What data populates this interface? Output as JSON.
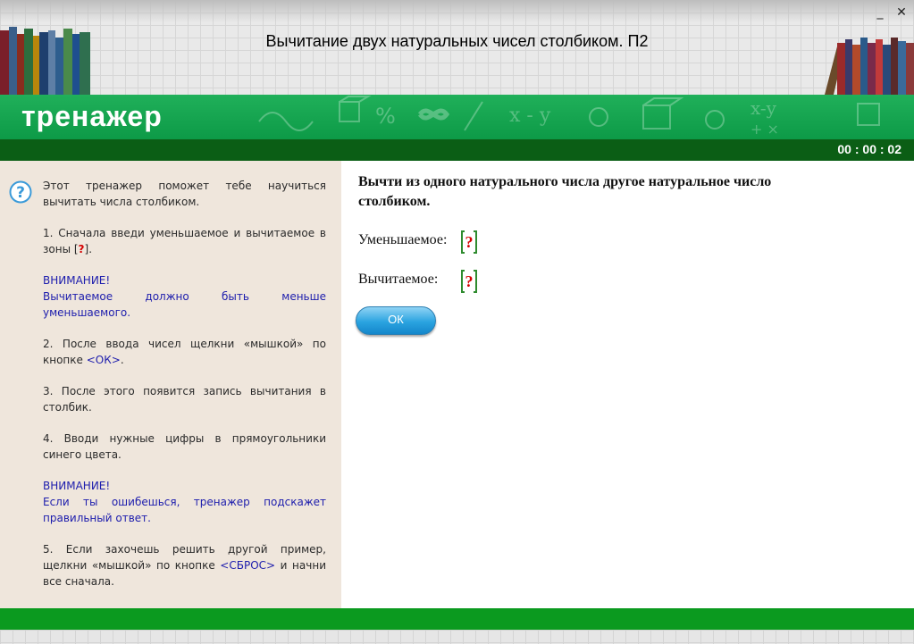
{
  "window": {
    "title": "Вычитание двух натуральных чисел столбиком. П2",
    "minimize_label": "_",
    "close_label": "✕"
  },
  "banner": {
    "text": "тренажер"
  },
  "timer": {
    "value": "00 : 00 : 02"
  },
  "instructions": {
    "intro": "Этот тренажер поможет тебе научиться вычитать числа столбиком.",
    "step1_before": "1. Сначала введи уменьшаемое и вычитаемое в зоны [",
    "step1_mark": "?",
    "step1_after": "].",
    "warning1_title": "ВНИМАНИЕ!",
    "warning1_text": "Вычитаемое должно быть меньше уменьшаемого.",
    "step2_before": "2. После ввода чисел щелкни «мышкой» по кнопке ",
    "step2_link": "<ОК>",
    "step2_after": ".",
    "step3": "3. После этого появится запись вычитания в столбик.",
    "step4": "4. Вводи нужные цифры в прямоугольники синего цвета.",
    "warning2_title": "ВНИМАНИЕ!",
    "warning2_text": "Если ты ошибешься, тренажер подскажет правильный ответ.",
    "step5_before": "5. Если захочешь решить другой пример, щелкни «мышкой» по кнопке ",
    "step5_link": "<СБРОС>",
    "step5_after": " и начни все сначала."
  },
  "main": {
    "task": "Вычти из одного натурального числа другое натуральное число столбиком.",
    "minuend_label": "Уменьшаемое:",
    "minuend_value": "?",
    "subtrahend_label": "Вычитаемое:",
    "subtrahend_value": "?",
    "ok_label": "ОК"
  },
  "colors": {
    "banner_green": "#20b05a",
    "timer_bar": "#0b5e15",
    "footer_green": "#0b9a1f",
    "left_panel": "#efe6dc",
    "ok_button_blue": "#2aa3e0",
    "question_red": "#d40000"
  },
  "icons": {
    "help": "help-circle-icon"
  }
}
